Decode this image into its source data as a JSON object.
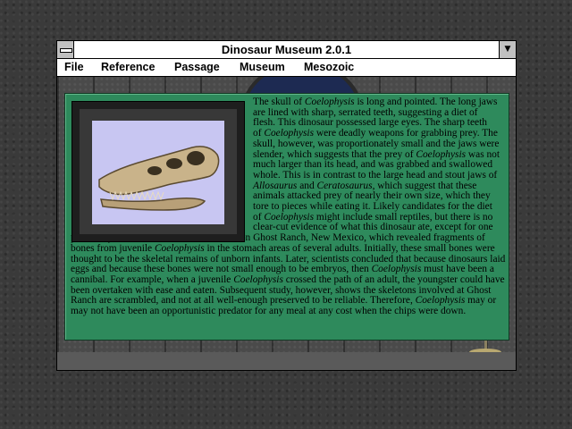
{
  "window": {
    "title": "Dinosaur Museum 2.0.1",
    "maximize_glyph": "▼"
  },
  "menu": [
    "File",
    "Reference",
    "Passage",
    "Museum",
    "Mesozoic"
  ],
  "article": {
    "lines": [
      [
        "The skull of ",
        "*Coelophysis",
        " is long and pointed.  The long jaws"
      ],
      [
        "are lined with sharp, serrated teeth, suggesting a diet of"
      ],
      [
        "flesh.  This dinosaur possessed large eyes.  The sharp teeth"
      ],
      [
        "of ",
        "*Coelophysis",
        " were deadly weapons for grabbing prey.  The"
      ],
      [
        "skull, however, was proportionately small and the jaws were"
      ],
      [
        "slender, which suggests that the prey of ",
        "*Coelophysis",
        " was not"
      ],
      [
        "much larger than its head, and was grabbed and swallowed"
      ],
      [
        "whole.  This is in contrast to the large head and stout jaws of"
      ],
      [
        "*Allosaurus",
        " and ",
        "*Ceratosaurus",
        ", which suggest that these"
      ],
      [
        "animals attacked prey of nearly  their own size, which they"
      ],
      [
        "tore to pieces while eating it.  Likely candidates for the diet"
      ],
      [
        "of ",
        "*Coelophysis",
        " might include small reptiles, but there is no"
      ],
      [
        "clear-cut evidence of what this dinosaur ate, except for one"
      ],
      [
        "possibility.  That is found at the fossil site on Ghost Ranch, New Mexico, which revealed fragments of"
      ],
      [
        "bones from juvenile ",
        "*Coelophysis",
        " in the stomach areas of several adults.  Initially, these small bones were"
      ],
      [
        "thought to be the skeletal remains of unborn infants.  Later, scientists concluded that because dinosaurs laid"
      ],
      [
        "eggs and because these bones were not small enough to be embryos, then ",
        "*Coelophysis",
        " must have been a"
      ],
      [
        "cannibal.  For example, when a juvenile ",
        "*Coelophysis",
        " crossed the path of an adult, the youngster could have"
      ],
      [
        "been overtaken with ease and eaten.  Subsequent study, however, shows the skeletons involved at Ghost"
      ],
      [
        "Ranch are scrambled, and not at all well-enough preserved to be reliable.  Therefore, ",
        "*Coelophysis",
        " may or"
      ],
      [
        "may not have been an opportunistic predator for any meal at any cost when the chips were down."
      ]
    ]
  },
  "colors": {
    "panel": "#2e8a5c",
    "photo_bg": "#c8c6f2",
    "bone": "#c9b38a"
  },
  "icons": [
    "system-menu-icon",
    "maximize-arrow-icon",
    "dinosaur-skull-image"
  ]
}
